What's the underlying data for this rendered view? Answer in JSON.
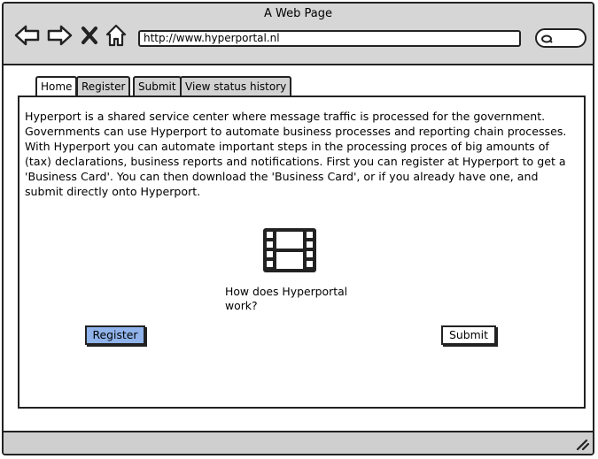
{
  "window": {
    "title": "A Web Page"
  },
  "toolbar": {
    "icons": [
      "back-arrow-icon",
      "forward-arrow-icon",
      "close-icon",
      "home-icon"
    ],
    "url": "http://www.hyperportal.nl",
    "search_icon": "search-icon"
  },
  "tabs": [
    {
      "label": "Home",
      "active": true
    },
    {
      "label": "Register",
      "active": false
    },
    {
      "label": "Submit",
      "active": false
    },
    {
      "label": "View status history",
      "active": false
    }
  ],
  "main": {
    "intro_lines": [
      "Hyperport is a shared service center where message traffic is processed for the government.",
      "Governments can use Hyperport to automate business processes and reporting chain processes.",
      "With Hyperport you can automate important steps in the processing proces of big amounts of",
      "(tax) declarations, business reports and notifications. First you can register at Hyperport to get a",
      "'Business Card'. You can then download the 'Business Card', or if you already have one, and",
      "submit directly onto Hyperport."
    ],
    "video_icon": "film-icon",
    "video_caption_lines": [
      "How does Hyperportal",
      "work?"
    ],
    "register_button": "Register",
    "submit_button": "Submit"
  },
  "colors": {
    "chrome": "#d6d6d6",
    "accent_button": "#8fb3ea",
    "border": "#222222"
  }
}
